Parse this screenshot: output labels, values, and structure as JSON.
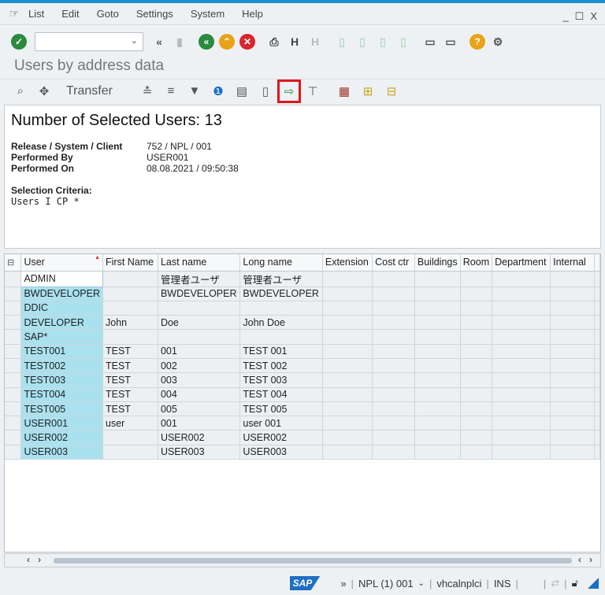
{
  "menu": {
    "items": [
      "List",
      "Edit",
      "Goto",
      "Settings",
      "System",
      "Help"
    ]
  },
  "window_controls": {
    "minimize": "_",
    "maximize": "☐",
    "close": "X"
  },
  "toolbar": {
    "command_value": "",
    "icons": [
      "enter-icon",
      "back-icon",
      "save-icon",
      "back-green-icon",
      "exit-icon",
      "cancel-icon",
      "print-icon",
      "find-icon",
      "find-next-icon",
      "first-page-icon",
      "previous-page-icon",
      "next-page-icon",
      "last-page-icon",
      "create-session-icon",
      "shortcut-icon",
      "help-icon",
      "settings-icon"
    ]
  },
  "title": "Users by address data",
  "app_toolbar": {
    "transfer_label": "Transfer",
    "highlighted": "export-icon"
  },
  "report": {
    "heading": "Number of Selected Users: 13",
    "rows": [
      {
        "k": "Release / System / Client",
        "v": "752 / NPL / 001"
      },
      {
        "k": "Performed By",
        "v": "USER001"
      },
      {
        "k": "Performed On",
        "v": "08.08.2021 / 09:50:38"
      }
    ],
    "criteria_label": "Selection Criteria:",
    "criteria_value": "Users I CP *"
  },
  "table": {
    "columns": [
      "User",
      "First Name",
      "Last name",
      "Long name",
      "Extension",
      "Cost ctr",
      "Buildings",
      "Room",
      "Department",
      "Internal"
    ],
    "rows": [
      [
        "ADMIN",
        "",
        "管理者ユーザ",
        "管理者ユーザ"
      ],
      [
        "BWDEVELOPER",
        "",
        "BWDEVELOPER",
        "BWDEVELOPER"
      ],
      [
        "DDIC",
        "",
        "",
        ""
      ],
      [
        "DEVELOPER",
        "John",
        "Doe",
        "John Doe"
      ],
      [
        "SAP*",
        "",
        "",
        ""
      ],
      [
        "TEST001",
        "TEST",
        "001",
        "TEST 001"
      ],
      [
        "TEST002",
        "TEST",
        "002",
        "TEST 002"
      ],
      [
        "TEST003",
        "TEST",
        "003",
        "TEST 003"
      ],
      [
        "TEST004",
        "TEST",
        "004",
        "TEST 004"
      ],
      [
        "TEST005",
        "TEST",
        "005",
        "TEST 005"
      ],
      [
        "USER001",
        "user",
        "001",
        "user 001"
      ],
      [
        "USER002",
        "",
        "USER002",
        "USER002"
      ],
      [
        "USER003",
        "",
        "USER003",
        "USER003"
      ]
    ]
  },
  "status": {
    "logo": "SAP",
    "system": "NPL (1) 001",
    "server": "vhcalnplci",
    "mode": "INS"
  },
  "colors": {
    "accent": "#1e90d0",
    "key_column": "#a9e1ef",
    "highlight": "#e0161e"
  }
}
